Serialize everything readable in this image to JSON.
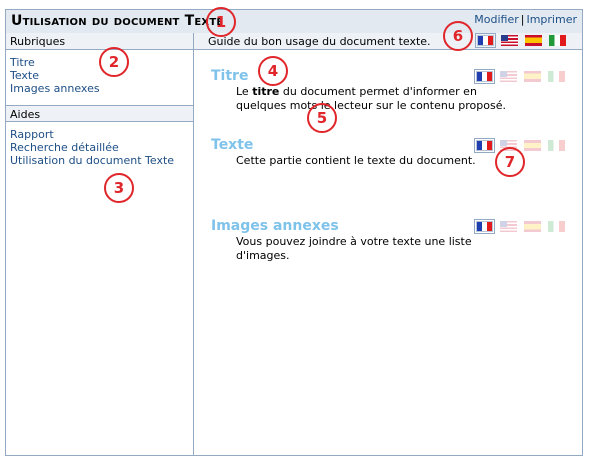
{
  "header": {
    "title": "Utilisation du document Texte",
    "links": {
      "edit": "Modifier",
      "separator": "|",
      "print": "Imprimer"
    }
  },
  "sidebar": {
    "rubriques": {
      "heading": "Rubriques",
      "items": [
        "Titre",
        "Texte",
        "Images annexes"
      ]
    },
    "aides": {
      "heading": "Aides",
      "items": [
        "Rapport",
        "Recherche détaillée",
        "Utilisation du document Texte"
      ]
    }
  },
  "main": {
    "heading": "Guide du bon usage du document texte.",
    "sections": [
      {
        "title": "Titre",
        "text_prefix": "Le ",
        "text_bold": "titre",
        "text_suffix": " du document permet d'informer en quelques mots le lecteur sur le contenu proposé."
      },
      {
        "title": "Texte",
        "text": "Cette partie contient le texte du document."
      },
      {
        "title": "Images annexes",
        "text": "Vous pouvez joindre à votre texte une liste d'images."
      }
    ]
  },
  "flags": [
    "fr-flag-icon",
    "us-flag-icon",
    "es-flag-icon",
    "it-flag-icon"
  ],
  "callouts": [
    "1",
    "2",
    "3",
    "4",
    "5",
    "6",
    "7"
  ],
  "colors": {
    "border": "#94a9c2",
    "header_bg": "#e2e9f1",
    "link": "#1e4f86",
    "section_title": "#7fc2ea",
    "callout": "#e0262a"
  }
}
